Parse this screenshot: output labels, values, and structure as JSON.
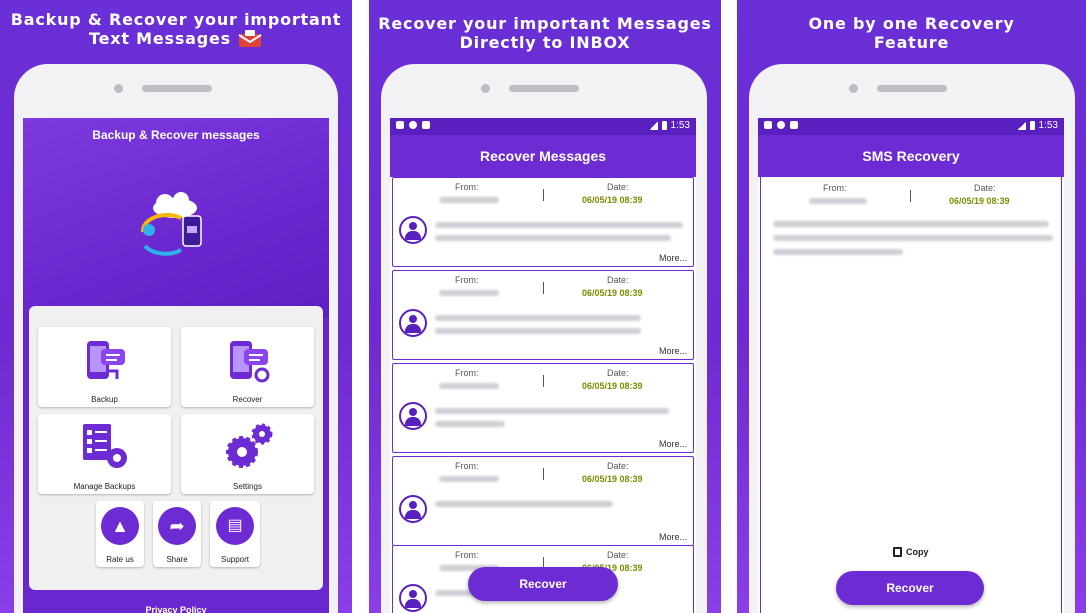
{
  "panels": [
    {
      "title_line1": "Backup & Recover your important",
      "title_line2": "Text Messages",
      "screen_title": "Backup & Recover messages",
      "tiles": [
        {
          "label": "Backup",
          "icon": "phone-chat-backup-icon"
        },
        {
          "label": "Recover",
          "icon": "phone-chat-recover-icon"
        },
        {
          "label": "Manage Backups",
          "icon": "checklist-gear-icon"
        },
        {
          "label": "Settings",
          "icon": "gears-icon"
        }
      ],
      "small_tiles": [
        {
          "label": "Rate us",
          "icon": "thumbs-up-icon"
        },
        {
          "label": "Share",
          "icon": "share-icon"
        },
        {
          "label": "Support",
          "icon": "support-chat-icon"
        }
      ],
      "footer_link": "Privacy Policy"
    },
    {
      "title_line1": "Recover your important Messages",
      "title_line2": "Directly to INBOX",
      "status_time": "1:53",
      "app_title": "Recover Messages",
      "from_label": "From:",
      "date_label": "Date:",
      "date_value": "06/05/19 08:39",
      "more_label": "More...",
      "button_label": "Recover"
    },
    {
      "title_line1": "One by one Recovery",
      "title_line2": "Feature",
      "status_time": "1:53",
      "app_title": "SMS Recovery",
      "from_label": "From:",
      "date_label": "Date:",
      "date_value": "06/05/19 08:39",
      "copy_label": "Copy",
      "button_label": "Recover"
    }
  ],
  "colors": {
    "brand": "#6d2bd4",
    "statusbar": "#5a1fbf",
    "date": "#7a8c00"
  }
}
